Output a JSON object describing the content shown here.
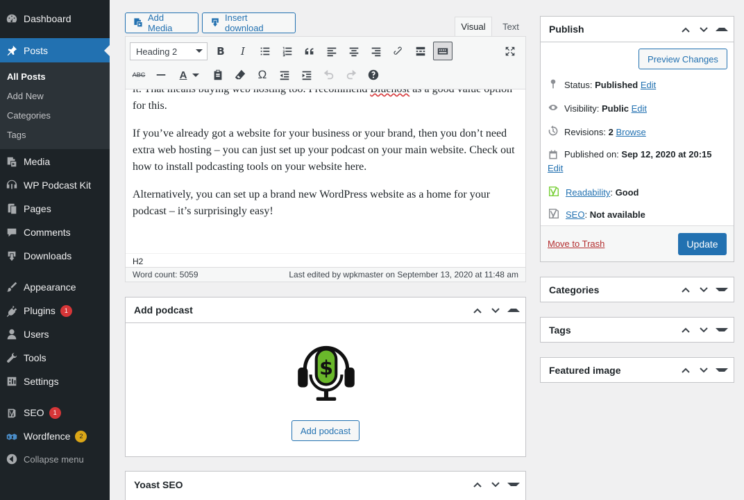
{
  "menu": {
    "items": [
      {
        "label": "Dashboard"
      },
      {
        "label": "Posts"
      },
      {
        "label": "Media"
      },
      {
        "label": "WP Podcast Kit"
      },
      {
        "label": "Pages"
      },
      {
        "label": "Comments"
      },
      {
        "label": "Downloads"
      },
      {
        "label": "Appearance"
      },
      {
        "label": "Plugins",
        "badge": "1"
      },
      {
        "label": "Users"
      },
      {
        "label": "Tools"
      },
      {
        "label": "Settings"
      },
      {
        "label": "SEO",
        "badge": "1"
      },
      {
        "label": "Wordfence",
        "badge": "2"
      }
    ],
    "submenu": [
      "All Posts",
      "Add New",
      "Categories",
      "Tags"
    ],
    "collapse": "Collapse menu"
  },
  "editor": {
    "add_media": "Add Media",
    "insert_download": "Insert download",
    "tab_visual": "Visual",
    "tab_text": "Text",
    "format_select": "Heading 2",
    "paragraphs": {
      "p1_start": "it. That means buying web hosting too. I recommend ",
      "p1_link": "Bluehost",
      "p1_end": " as a good value option for this.",
      "p2": "If you’ve already got a website for your business or your brand, then you don’t need extra web hosting – you can just set up your podcast on your main website. Check out how to install podcasting tools on your website here.",
      "p3": "Alternatively, you can set up a brand new WordPress website as a home for your podcast – it’s surprisingly easy!"
    },
    "path": "H2",
    "word_count": "Word count: 5059",
    "last_edited": "Last edited by wpkmaster on September 13, 2020 at 11:48 am"
  },
  "podcast_box": {
    "title": "Add podcast",
    "button": "Add podcast"
  },
  "yoast_box": {
    "title": "Yoast SEO"
  },
  "publish": {
    "title": "Publish",
    "preview": "Preview Changes",
    "status_label": "Status: ",
    "status_value": "Published",
    "visibility_label": "Visibility: ",
    "visibility_value": "Public",
    "revisions_label": "Revisions: ",
    "revisions_value": "2",
    "browse": "Browse",
    "published_label": "Published on: ",
    "published_value": "Sep 12, 2020 at 20:15",
    "edit": "Edit",
    "readability_link": "Readability",
    "readability_value": "Good",
    "seo_link": "SEO",
    "seo_value": "Not available",
    "trash": "Move to Trash",
    "update": "Update"
  },
  "side_boxes": {
    "categories": "Categories",
    "tags": "Tags",
    "featured": "Featured image"
  },
  "colors": {
    "accent": "#2271b1",
    "menu_bg": "#1d2327",
    "badge_red": "#d63638",
    "badge_orange": "#dba617",
    "yoast_good": "#7ad03a"
  }
}
